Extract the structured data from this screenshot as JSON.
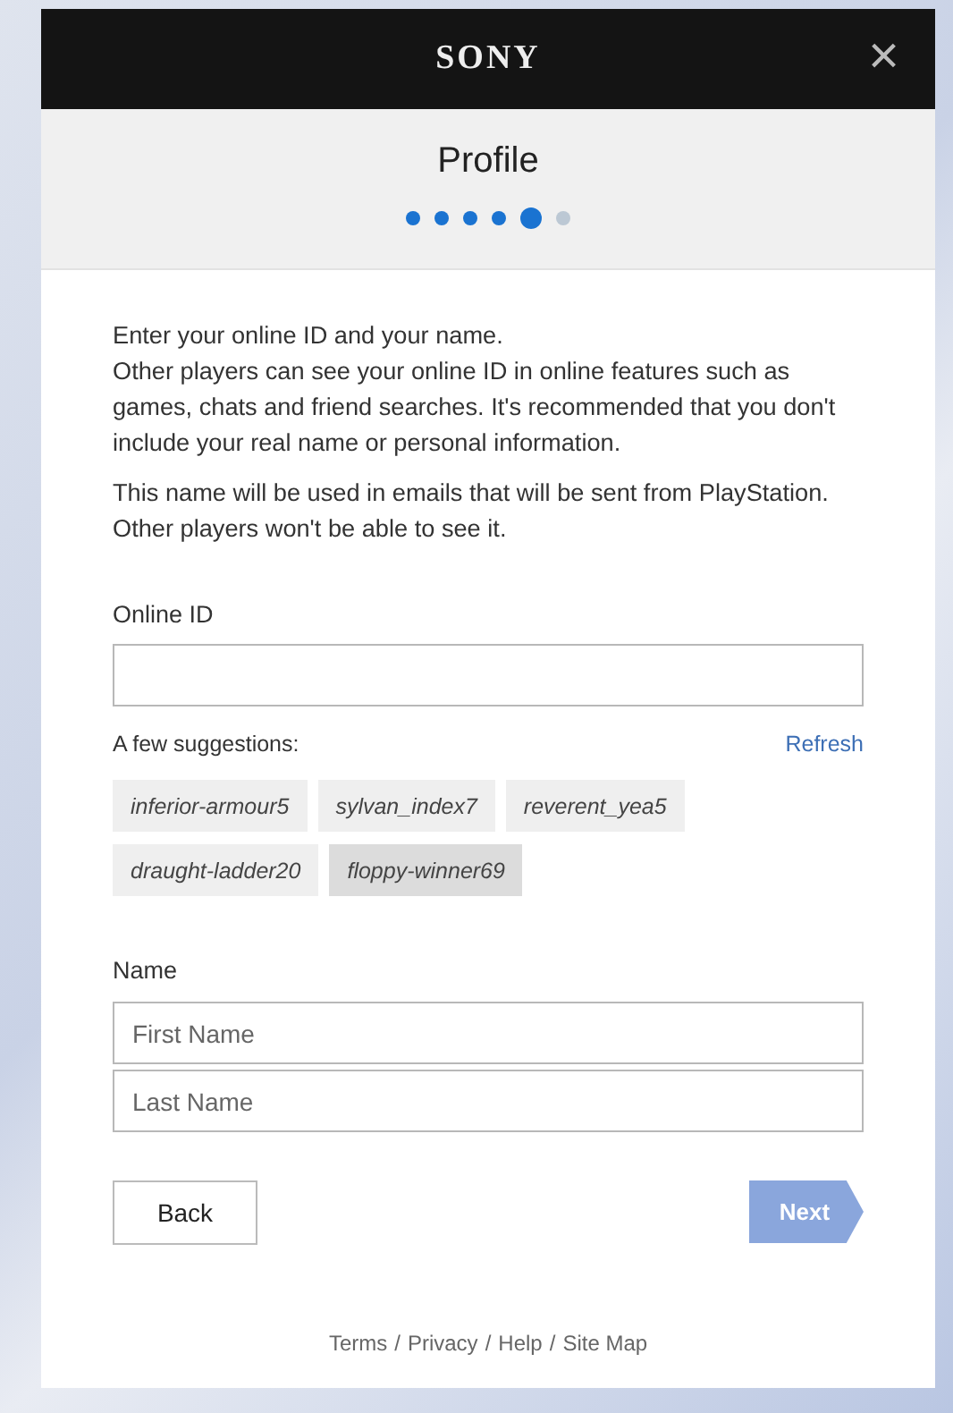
{
  "header": {
    "logo": "SONY",
    "close": "×"
  },
  "title": "Profile",
  "steps": [
    {
      "done": true,
      "selected": false
    },
    {
      "done": true,
      "selected": false
    },
    {
      "done": true,
      "selected": false
    },
    {
      "done": true,
      "selected": false
    },
    {
      "done": true,
      "selected": true
    },
    {
      "done": false,
      "selected": false
    }
  ],
  "intro": [
    "Enter your online ID and your name.\nOther players can see your online ID in online features such as games, chats and friend searches. It's recommended that you don't include your real name or personal information.",
    "This name will be used in emails that will be sent from PlayStation. Other players won't be able to see it."
  ],
  "online_id": {
    "label": "Online ID"
  },
  "suggestions": {
    "label": "A few suggestions:",
    "refresh": "Refresh",
    "items": [
      {
        "text": "inferior-armour5",
        "selected": false
      },
      {
        "text": "sylvan_index7",
        "selected": false
      },
      {
        "text": "reverent_yea5",
        "selected": false
      },
      {
        "text": "draught-ladder20",
        "selected": false
      },
      {
        "text": "floppy-winner69",
        "selected": true
      }
    ]
  },
  "name": {
    "label": "Name",
    "fields": [
      {
        "placeholder": "First Name"
      },
      {
        "placeholder": "Last Name"
      }
    ]
  },
  "buttons": {
    "back": {
      "label": "Back"
    },
    "next": {
      "label": "Next",
      "disabled": true
    }
  },
  "footer": {
    "links": [
      "Terms",
      "Privacy",
      "Help",
      "Site Map"
    ],
    "separator": "/"
  }
}
